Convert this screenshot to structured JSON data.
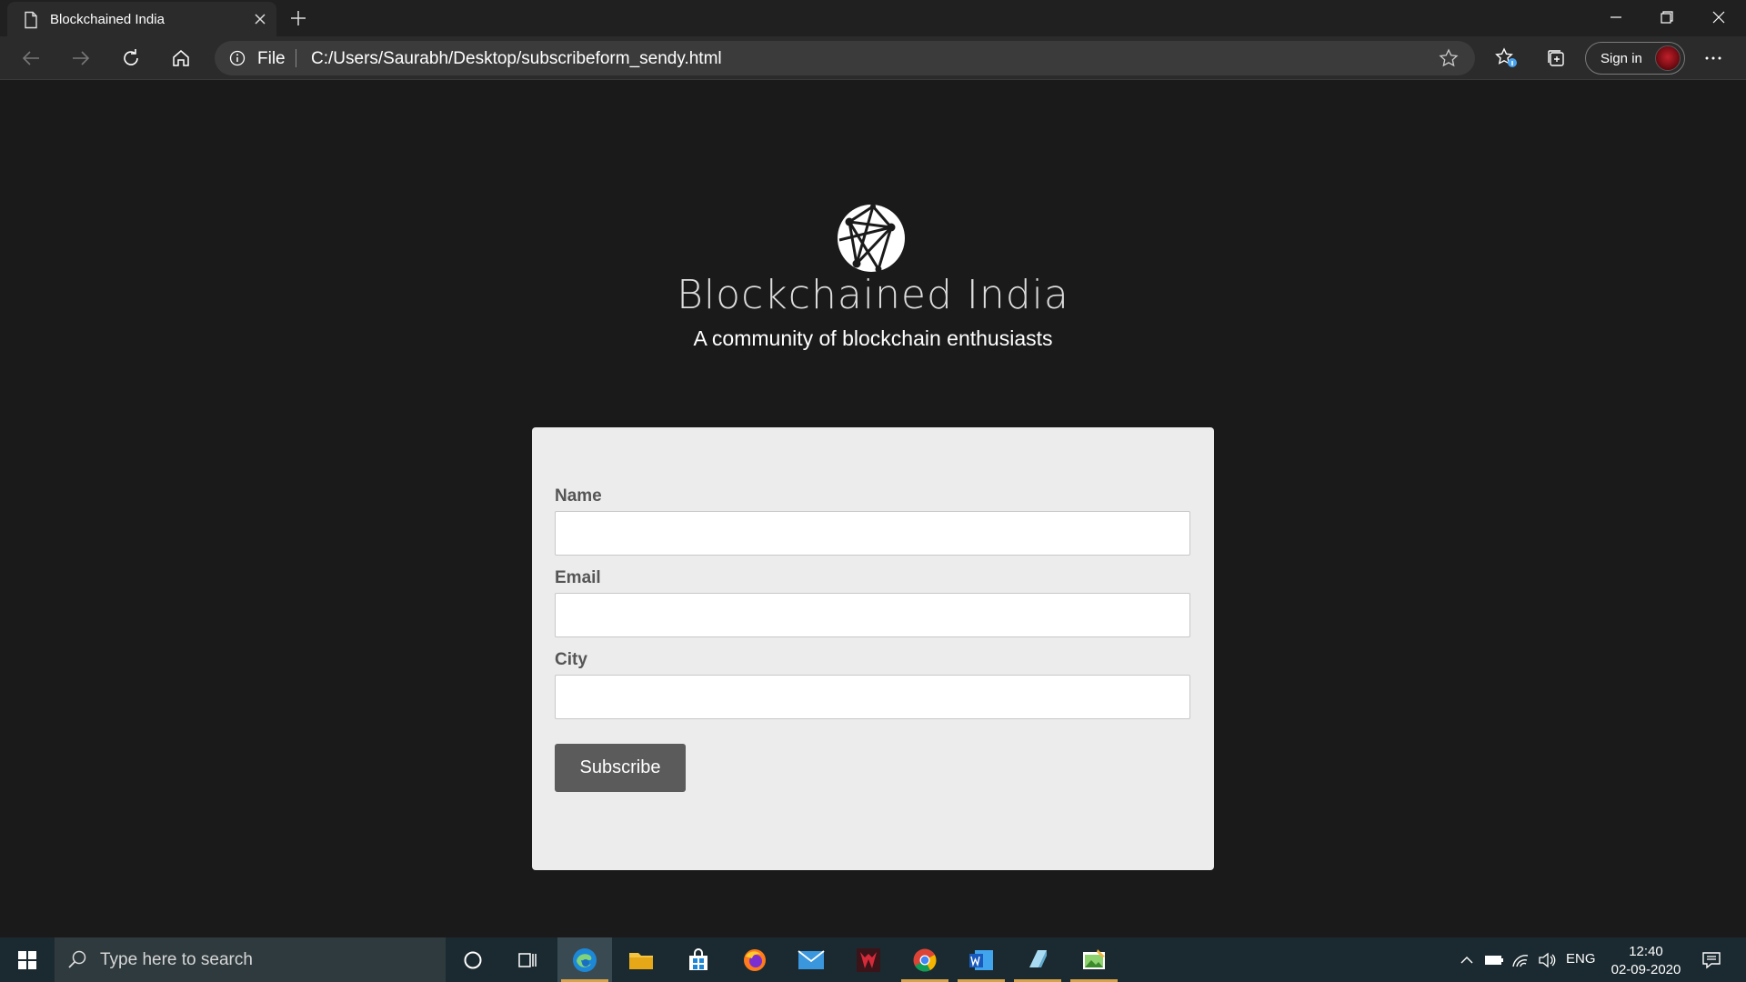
{
  "browser": {
    "tab_title": "Blockchained India",
    "scheme_label": "File",
    "url": "C:/Users/Saurabh/Desktop/subscribeform_sendy.html",
    "sign_in_label": "Sign in"
  },
  "page": {
    "brand": "Blockchained India",
    "tagline": "A community of blockchain enthusiasts",
    "form": {
      "name_label": "Name",
      "name_value": "",
      "email_label": "Email",
      "email_value": "",
      "city_label": "City",
      "city_value": "",
      "submit_label": "Subscribe"
    }
  },
  "taskbar": {
    "search_placeholder": "Type here to search",
    "pinned_apps": [
      "edge-icon",
      "file-explorer-icon",
      "store-icon",
      "firefox-icon",
      "mail-icon",
      "predator-icon",
      "chrome-icon",
      "word-icon",
      "notepad-icon",
      "paint-icon"
    ],
    "language": "ENG",
    "time": "12:40",
    "date": "02-09-2020"
  },
  "colors": {
    "page_background": "#1a1a1a",
    "card_background": "#ececec",
    "button_background": "#5b5b5b",
    "taskbar_background": "#1b2a30",
    "active_app_underline": "#d6a24a"
  }
}
